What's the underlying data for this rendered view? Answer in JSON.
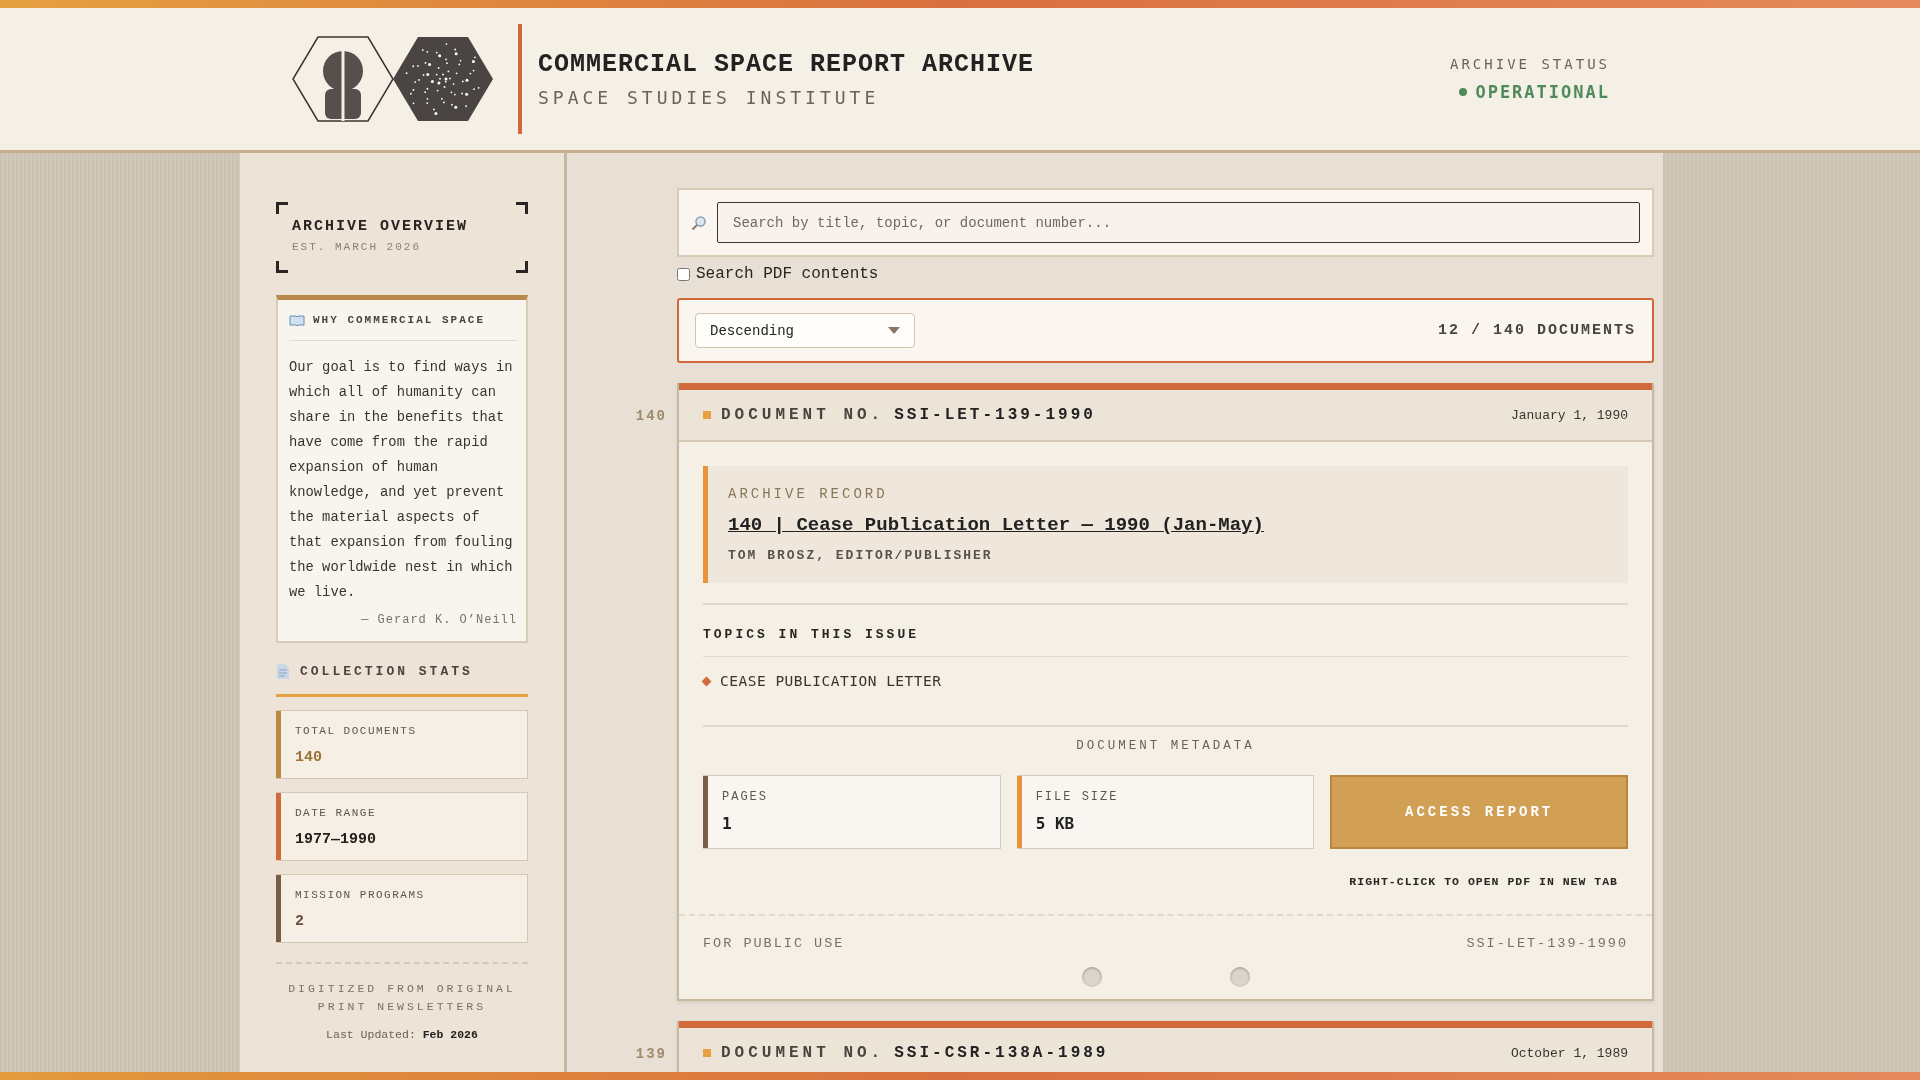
{
  "header": {
    "title": "COMMERCIAL SPACE REPORT ARCHIVE",
    "subtitle": "SPACE STUDIES INSTITUTE",
    "status_label": "ARCHIVE STATUS",
    "status_value": "OPERATIONAL"
  },
  "sidebar": {
    "overview": {
      "title": "ARCHIVE OVERVIEW",
      "established": "EST. MARCH 2026"
    },
    "quote": {
      "heading": "WHY COMMERCIAL SPACE",
      "text": "Our goal is to find ways in which all of humanity can share in the benefits that have come from the rapid expansion of human knowledge, and yet prevent the material aspects of that expansion from fouling the worldwide nest in which we live.",
      "attribution": "— Gerard K. O’Neill"
    },
    "stats": {
      "heading": "COLLECTION STATS",
      "items": [
        {
          "label": "TOTAL DOCUMENTS",
          "value": "140",
          "color": "#b8893f"
        },
        {
          "label": "DATE RANGE",
          "value": "1977—1990",
          "color": "#d06a3a"
        },
        {
          "label": "MISSION PROGRAMS",
          "value": "2",
          "color": "#7a5c48"
        }
      ]
    },
    "footer": {
      "note": "DIGITIZED FROM ORIGINAL PRINT NEWSLETTERS",
      "updated": "Last Updated: **Feb 2026**"
    }
  },
  "search": {
    "placeholder": "Search by title, topic, or document number...",
    "pdf_option": {
      "label": "Search PDF contents",
      "checked": false
    }
  },
  "toolbar": {
    "sort": "Descending",
    "count": "12 / 140 DOCUMENTS"
  },
  "documents": [
    {
      "index": "140",
      "doc_label": "DOCUMENT NO.",
      "doc_number": "SSI-LET-139-1990",
      "date": "January 1, 1990",
      "record_label": "ARCHIVE RECORD",
      "title": "140 | Cease Publication Letter — 1990 (Jan-May)",
      "author": "TOM BROSZ, EDITOR/PUBLISHER",
      "topics_heading": "TOPICS IN THIS ISSUE",
      "topics": [
        "CEASE PUBLICATION LETTER"
      ],
      "metadata_heading": "DOCUMENT METADATA",
      "metadata": [
        {
          "label": "PAGES",
          "value": "1",
          "color": "#7a5c48"
        },
        {
          "label": "FILE SIZE",
          "value": "5 KB",
          "color": "#e8923a"
        }
      ],
      "action": "ACCESS REPORT",
      "action_note": "RIGHT-CLICK TO OPEN PDF IN NEW TAB",
      "footer_left": "FOR PUBLIC USE",
      "footer_right": "SSI-LET-139-1990"
    },
    {
      "index": "139",
      "doc_label": "DOCUMENT NO.",
      "doc_number": "SSI-CSR-138A-1989",
      "date": "October 1, 1989"
    }
  ]
}
